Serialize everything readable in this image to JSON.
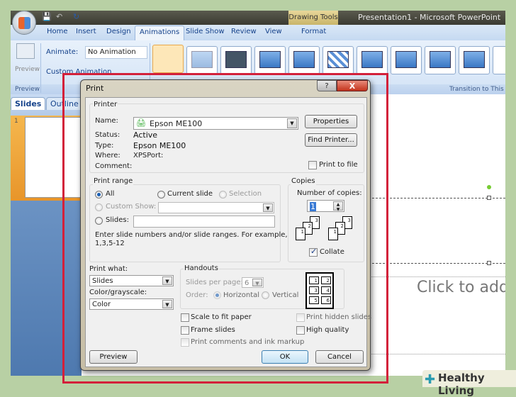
{
  "app": {
    "context_tab": "Drawing Tools",
    "title": "Presentation1 - Microsoft PowerPoint"
  },
  "tabs": [
    "Home",
    "Insert",
    "Design",
    "Animations",
    "Slide Show",
    "Review",
    "View",
    "Format"
  ],
  "ribbon": {
    "preview_label": "Preview",
    "preview_group": "Preview",
    "animate_label": "Animate:",
    "animate_value": "No Animation",
    "custom_animation": "Custom Animation",
    "transition_group": "Transition to This Slide"
  },
  "panes": {
    "slides_tab": "Slides",
    "outline_tab": "Outline",
    "slide_number": "1"
  },
  "slide": {
    "placeholder": "Click to add"
  },
  "dialog": {
    "title": "Print",
    "help": "?",
    "close": "X",
    "printer": {
      "group": "Printer",
      "name_label": "Name:",
      "name_value": "Epson ME100",
      "status_label": "Status:",
      "status_value": "Active",
      "type_label": "Type:",
      "type_value": "Epson ME100",
      "where_label": "Where:",
      "where_value": "XPSPort:",
      "comment_label": "Comment:",
      "properties": "Properties",
      "find_printer": "Find Printer...",
      "print_to_file": "Print to file",
      "print_to_file_checked": false
    },
    "range": {
      "group": "Print range",
      "all": "All",
      "current_slide": "Current slide",
      "selection": "Selection",
      "custom_show": "Custom Show:",
      "slides": "Slides:",
      "help_line1": "Enter slide numbers and/or slide ranges. For example,",
      "help_line2": "1,3,5-12",
      "selected": "All"
    },
    "copies": {
      "group": "Copies",
      "number_label": "Number of copies:",
      "number_value": "1",
      "collate": "Collate",
      "collate_checked": true,
      "pages": [
        "1",
        "2",
        "3"
      ]
    },
    "print_what": {
      "label": "Print what:",
      "value": "Slides"
    },
    "color": {
      "label": "Color/grayscale:",
      "value": "Color"
    },
    "handouts": {
      "group": "Handouts",
      "slides_per_page_label": "Slides per page:",
      "slides_per_page_value": "6",
      "order_label": "Order:",
      "horizontal": "Horizontal",
      "vertical": "Vertical",
      "pages": [
        "1",
        "2",
        "3",
        "4",
        "5",
        "6"
      ]
    },
    "options": {
      "scale": "Scale to fit paper",
      "frame": "Frame slides",
      "comments": "Print comments and ink markup",
      "hidden": "Print hidden slides",
      "high_quality": "High quality"
    },
    "buttons": {
      "preview": "Preview",
      "ok": "OK",
      "cancel": "Cancel"
    }
  },
  "watermark": {
    "brand": "Healthy Living"
  },
  "colors": {
    "highlight": "#d3203a",
    "background": "#b8d0a4"
  }
}
